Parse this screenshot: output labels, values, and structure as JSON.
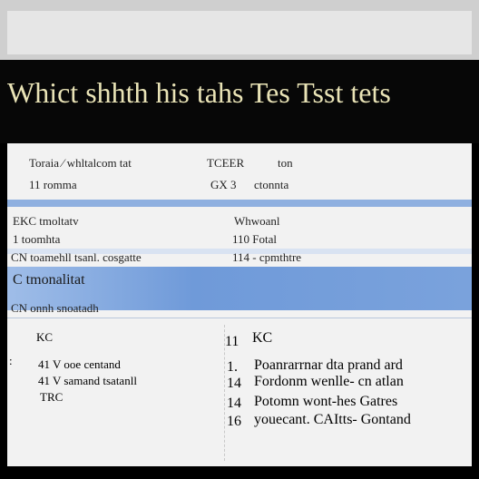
{
  "title": "Whict shhth his tahs Tes Tsst tets",
  "header": {
    "col1_line1": "Toraia ⁄ whltalcom tat",
    "col2_line1": "TCEER",
    "col3_line1": "ton",
    "col1_line2": "11 romma",
    "col2_line2": "GX 3",
    "col3_line2": "ctonnta"
  },
  "rows": [
    {
      "left": "EKC  tmoltatv",
      "right": "Whwoanl"
    },
    {
      "left": "1 toomhta",
      "right": "110 Fotal"
    },
    {
      "left": "CN toamehll tsanl. cosgatte",
      "right": "114 - cpmthtre"
    }
  ],
  "highlight": {
    "line1": "C   tmonalitat",
    "line2": "CN   onnh snoatadh"
  },
  "lower_left": {
    "heading": "KC",
    "lines": [
      "41 V    ooe centand",
      "41 V    samand   tsatanll",
      "TRC"
    ],
    "markers": [
      ":",
      "1",
      "+"
    ]
  },
  "lower_right": {
    "heading": "KC",
    "index_markers": [
      "11",
      "1.",
      "14",
      "14",
      "16"
    ],
    "lines": [
      "Poanrarrnar dta  prand ard",
      "Fordonm wenlle- cn atlan",
      "Potomn wont-hes Gatres",
      "youecant.  CAItts- Gontand"
    ]
  }
}
